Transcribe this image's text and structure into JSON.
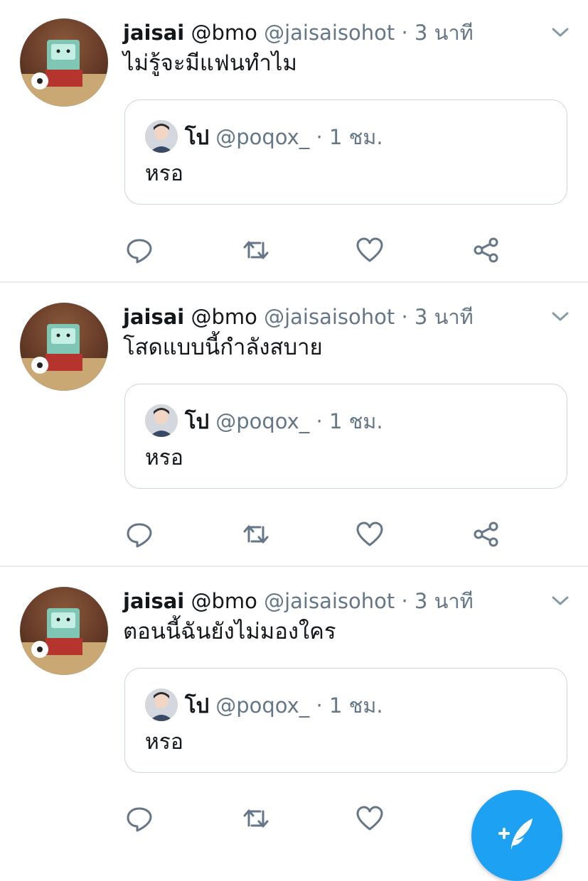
{
  "tweets": [
    {
      "name": "jaisai",
      "alt_handle": "@bmo",
      "handle": "@jaisaisohot",
      "separator": "·",
      "time": "3 นาที",
      "text": "ไม่รู้จะมีแฟนทำไม",
      "quote": {
        "name": "โป",
        "handle": "@poqox_",
        "separator": "·",
        "time": "1 ชม.",
        "text": "หรอ"
      }
    },
    {
      "name": "jaisai",
      "alt_handle": "@bmo",
      "handle": "@jaisaisohot",
      "separator": "·",
      "time": "3 นาที",
      "text": "โสดแบบนี้กำลังสบาย",
      "quote": {
        "name": "โป",
        "handle": "@poqox_",
        "separator": "·",
        "time": "1 ชม.",
        "text": "หรอ"
      }
    },
    {
      "name": "jaisai",
      "alt_handle": "@bmo",
      "handle": "@jaisaisohot",
      "separator": "·",
      "time": "3 นาที",
      "text": "ตอนนี้ฉันยังไม่มองใคร",
      "quote": {
        "name": "โป",
        "handle": "@poqox_",
        "separator": "·",
        "time": "1 ชม.",
        "text": "หรอ"
      }
    }
  ],
  "icons": {
    "reply": "reply-icon",
    "retweet": "retweet-icon",
    "like": "heart-icon",
    "share": "share-icon",
    "more": "chevron-down-icon",
    "compose": "compose-tweet-icon"
  },
  "colors": {
    "accent": "#1da1f2",
    "muted": "#657786",
    "border": "#ccd6dd",
    "divider": "#e6ecf0"
  }
}
